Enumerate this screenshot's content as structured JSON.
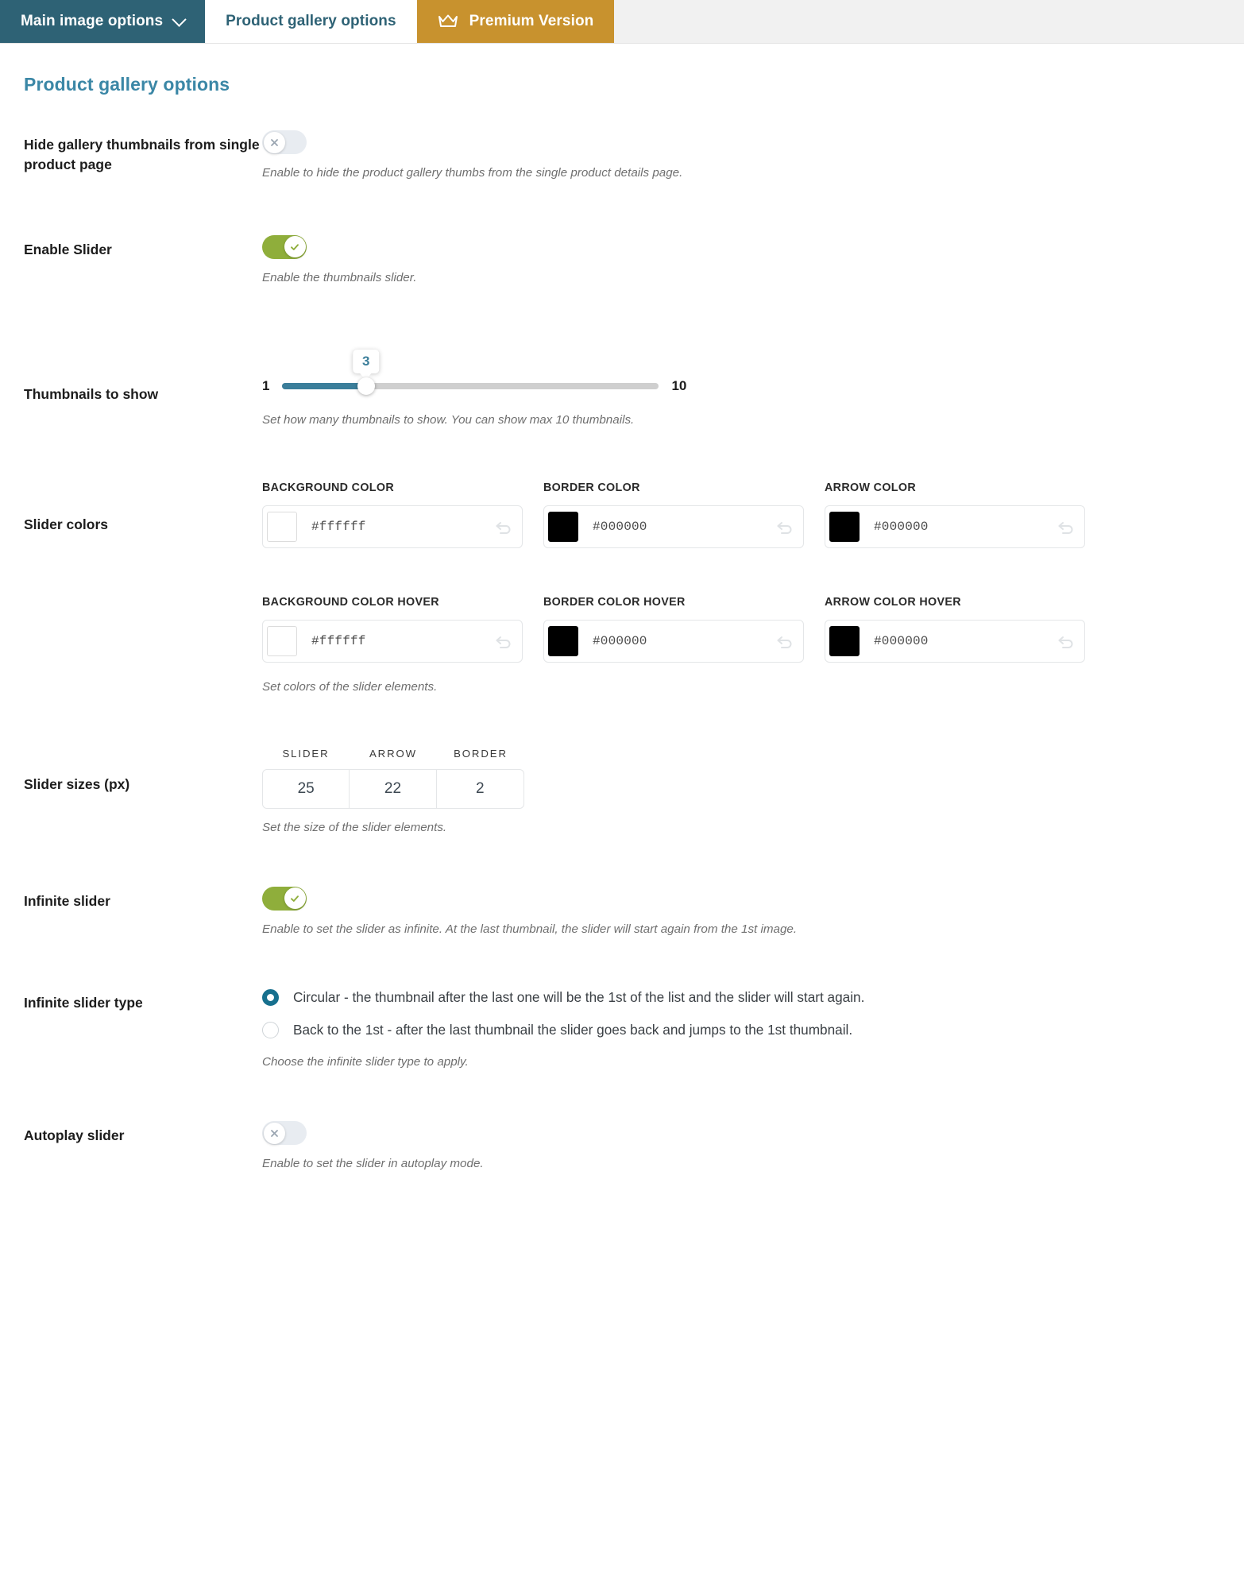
{
  "tabs": [
    {
      "label": "Main image options",
      "icon": "chevron-down-icon",
      "state": "inactive-dark"
    },
    {
      "label": "Product gallery options",
      "icon": null,
      "state": "active"
    },
    {
      "label": "Premium Version",
      "icon": "crown-icon",
      "state": "premium"
    }
  ],
  "page": {
    "title": "Product gallery options",
    "title_color": "#3b87a6"
  },
  "colors": {
    "tab_dark": "#2e6275",
    "tab_premium": "#c8922e",
    "toggle_on": "#8fae3b",
    "toggle_off": "#e8ecf1",
    "slider_fill": "#3b7e9a",
    "radio_checked": "#17708e"
  },
  "settings": [
    {
      "label": "Hide gallery thumbnails from single product page",
      "type": "toggle",
      "value": "off",
      "description": "Enable to hide the product gallery thumbs from the single product details page."
    },
    {
      "label": "Enable Slider",
      "type": "toggle",
      "value": "on",
      "description": "Enable the thumbnails slider."
    },
    {
      "label": "Thumbnails to show",
      "type": "range",
      "value": "3",
      "min": "1",
      "max": "10",
      "description": "Set how many thumbnails to show. You can show max 10 thumbnails."
    },
    {
      "label": "Slider colors",
      "type": "colors",
      "description": "Set colors of the slider elements.",
      "row1": [
        {
          "label": "BACKGROUND COLOR",
          "hex": "#ffffff",
          "swatch": "#ffffff",
          "reset_icon": "undo-icon"
        },
        {
          "label": "BORDER COLOR",
          "hex": "#000000",
          "swatch": "#000000",
          "reset_icon": "undo-icon"
        },
        {
          "label": "ARROW COLOR",
          "hex": "#000000",
          "swatch": "#000000",
          "reset_icon": "undo-icon"
        }
      ],
      "row2": [
        {
          "label": "BACKGROUND COLOR HOVER",
          "hex": "#ffffff",
          "swatch": "#ffffff",
          "reset_icon": "undo-icon"
        },
        {
          "label": "BORDER COLOR HOVER",
          "hex": "#000000",
          "swatch": "#000000",
          "reset_icon": "undo-icon"
        },
        {
          "label": "ARROW COLOR HOVER",
          "hex": "#000000",
          "swatch": "#000000",
          "reset_icon": "undo-icon"
        }
      ]
    },
    {
      "label": "Slider sizes (px)",
      "type": "sizes",
      "description": "Set the size of the slider elements.",
      "fields": [
        {
          "label": "SLIDER",
          "value": "25"
        },
        {
          "label": "ARROW",
          "value": "22"
        },
        {
          "label": "BORDER",
          "value": "2"
        }
      ]
    },
    {
      "label": "Infinite slider",
      "type": "toggle",
      "value": "on",
      "description": "Enable to set the slider as infinite. At the last thumbnail, the slider will start again from the 1st image."
    },
    {
      "label": "Infinite slider type",
      "type": "radio",
      "description": "Choose the infinite slider type to apply.",
      "options": [
        {
          "label": "Circular - the thumbnail after the last one will be the 1st of the list and the slider will start again.",
          "checked": true
        },
        {
          "label": "Back to the 1st - after the last thumbnail the slider goes back and jumps to the 1st thumbnail.",
          "checked": false
        }
      ]
    },
    {
      "label": "Autoplay slider",
      "type": "toggle",
      "value": "off",
      "description": "Enable to set the slider in autoplay mode."
    }
  ]
}
